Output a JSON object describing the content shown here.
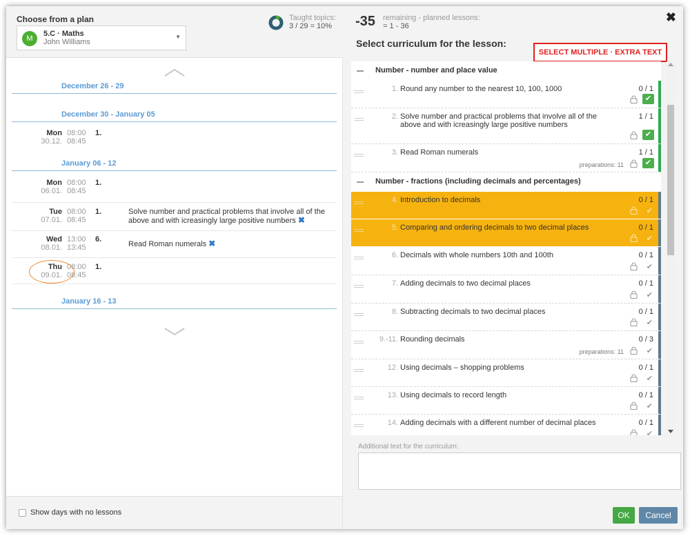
{
  "left": {
    "title": "Choose from a plan",
    "plan": {
      "avatar_letter": "M",
      "name": "5.C · Maths",
      "teacher": "John Williams"
    },
    "taught_label": "Taught topics:",
    "taught_value": "3 / 29 = 10%",
    "taught_fraction": 0.1,
    "weeks": [
      "December 26 - 29",
      "December 30 - January 05",
      "January 06 - 12",
      "January 16 - 13"
    ],
    "lessons": [
      {
        "day": "Mon",
        "date": "30.12.",
        "start": "08:00",
        "end": "08:45",
        "num": "1.",
        "topic": ""
      },
      {
        "day": "Mon",
        "date": "06.01.",
        "start": "08:00",
        "end": "08:45",
        "num": "1.",
        "topic": ""
      },
      {
        "day": "Tue",
        "date": "07.01.",
        "start": "08:00",
        "end": "08:45",
        "num": "1.",
        "topic": "Solve number and practical problems that involve all of the above and with icreasingly large positive numbers"
      },
      {
        "day": "Wed",
        "date": "08.01.",
        "start": "13:00",
        "end": "13:45",
        "num": "6.",
        "topic": "Read Roman numerals"
      },
      {
        "day": "Thu",
        "date": "09.01.",
        "start": "08:00",
        "end": "08:45",
        "num": "1.",
        "topic": ""
      }
    ],
    "footer_checkbox_label": "Show days with no lessons"
  },
  "right": {
    "remaining_number": "-35",
    "remaining_label": "remaining - planned lessons:",
    "remaining_value": "= 1 - 36",
    "title": "Select curriculum for the lesson:",
    "select_multiple": "SELECT MULTIPLE · EXTRA TEXT",
    "groups": [
      {
        "label": "Number - number and place value"
      },
      {
        "label": "Number - fractions (including decimals and percentages)"
      }
    ],
    "items": [
      {
        "num": "1.",
        "text": "Round any number to the nearest 10, 100, 1000",
        "count": "0 / 1",
        "prep": "",
        "checked": true,
        "highlight": false
      },
      {
        "num": "2.",
        "text": "Solve number and practical problems that involve all of the above and with icreasingly large positive numbers",
        "count": "1 / 1",
        "prep": "",
        "checked": true,
        "highlight": false
      },
      {
        "num": "3.",
        "text": "Read Roman numerals",
        "count": "1 / 1",
        "prep": "preparations: 11",
        "checked": true,
        "highlight": false
      },
      {
        "num": "4.",
        "text": "Introduction to decimals",
        "count": "0 / 1",
        "prep": "",
        "checked": false,
        "highlight": true
      },
      {
        "num": "5.",
        "text": "Comparing and ordering decimals to two decimal places",
        "count": "0 / 1",
        "prep": "",
        "checked": false,
        "highlight": true
      },
      {
        "num": "6.",
        "text": "Decimals with whole numbers 10th and 100th",
        "count": "0 / 1",
        "prep": "",
        "checked": false,
        "highlight": false
      },
      {
        "num": "7.",
        "text": "Adding decimals to two decimal places",
        "count": "0 / 1",
        "prep": "",
        "checked": false,
        "highlight": false
      },
      {
        "num": "8.",
        "text": "Subtracting decimals to two decimal places",
        "count": "0 / 1",
        "prep": "",
        "checked": false,
        "highlight": false
      },
      {
        "num": "9.-11.",
        "text": "Rounding decimals",
        "count": "0 / 3",
        "prep": "preparations: 11",
        "checked": false,
        "highlight": false
      },
      {
        "num": "12.",
        "text": "Using decimals – shopping problems",
        "count": "0 / 1",
        "prep": "",
        "checked": false,
        "highlight": false
      },
      {
        "num": "13.",
        "text": "Using decimals to record length",
        "count": "0 / 1",
        "prep": "",
        "checked": false,
        "highlight": false
      },
      {
        "num": "14.",
        "text": "Adding decimals with a different number of decimal places",
        "count": "0 / 1",
        "prep": "",
        "checked": false,
        "highlight": false
      }
    ],
    "additional_label": "Additional text for the curriculum:",
    "additional_value": "",
    "ok_label": "OK",
    "cancel_label": "Cancel",
    "close_icon": "✖",
    "colors": {
      "highlight": "#f6b20f",
      "done_bar": "#2eaa52",
      "open_bar": "#5f7b8c",
      "ok": "#45a845",
      "cancel": "#5f88a8",
      "select_multiple": "#e02020"
    }
  }
}
